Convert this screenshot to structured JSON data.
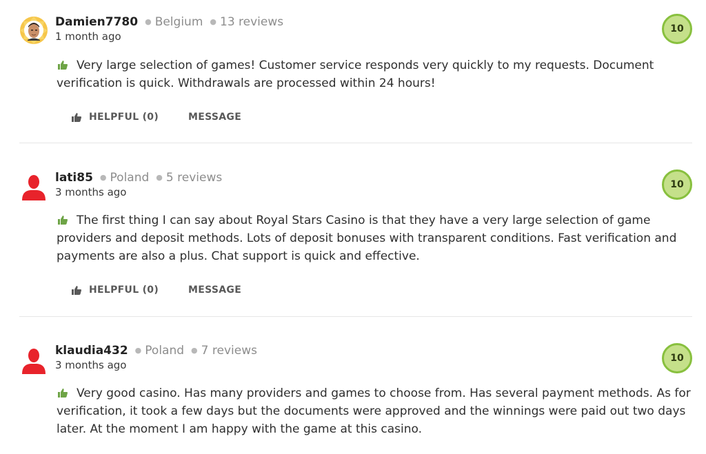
{
  "reviews": [
    {
      "username": "Damien7780",
      "country": "Belgium",
      "reviews_count": "13 reviews",
      "date": "1 month ago",
      "score": "10",
      "text": "Very large selection of games! Customer service responds very quickly to my requests. Document verification is quick. Withdrawals are processed within 24 hours!",
      "helpful_label": "HELPFUL (0)",
      "message_label": "MESSAGE",
      "avatar": "user-photo-avatar"
    },
    {
      "username": "lati85",
      "country": "Poland",
      "reviews_count": "5 reviews",
      "date": "3 months ago",
      "score": "10",
      "text": "The first thing I can say about Royal Stars Casino is that they have a very large selection of game providers and deposit methods. Lots of deposit bonuses with transparent conditions. Fast verification and payments are also a plus. Chat support is quick and effective.",
      "helpful_label": "HELPFUL (0)",
      "message_label": "MESSAGE",
      "avatar": "default-user-icon"
    },
    {
      "username": "klaudia432",
      "country": "Poland",
      "reviews_count": "7 reviews",
      "date": "3 months ago",
      "score": "10",
      "text": "Very good casino. Has many providers and games to choose from. Has several payment methods. As for verification, it took a few days but the documents were approved and the winnings were paid out two days later. At the moment I am happy with the game at this casino.",
      "avatar": "default-user-icon"
    }
  ],
  "colors": {
    "score_fill": "#c5e08a",
    "score_ring": "#88c03e",
    "positive_thumb": "#6ea446",
    "default_avatar": "#e8232b"
  }
}
